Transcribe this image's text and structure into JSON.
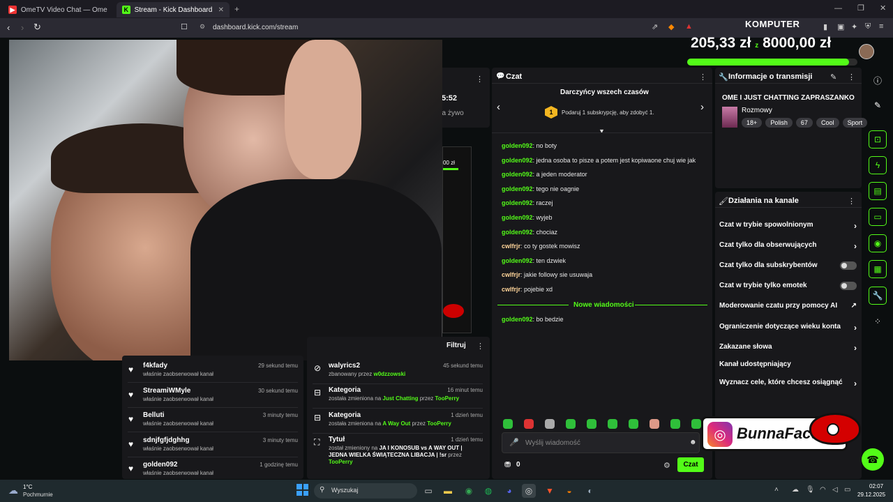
{
  "browser": {
    "tabs": [
      {
        "title": "OmeTV Video Chat — Omegle R"
      },
      {
        "title": "Stream - Kick Dashboard"
      }
    ],
    "url": "dashboard.kick.com/stream"
  },
  "overlay": {
    "logo_text": "KOMPUTER",
    "goal_current": "205,33 zł",
    "goal_separator": "z",
    "goal_target": "8000,00 zł",
    "partial_time": "5:52",
    "partial_live": "na żywo",
    "partial_value": "00 zł",
    "instagram_handle": "BunnaFactory"
  },
  "chat": {
    "title": "Czat",
    "top_gifters_title": "Darczyńcy wszech czasów",
    "top_rank": "1",
    "top_gifter_text": "Podaruj 1 subskrypcję, aby zdobyć 1.",
    "messages": [
      {
        "user": "golden092",
        "text": "no boty"
      },
      {
        "user": "golden092",
        "text": "jedna osoba to pisze a potem jest kopiwaone chuj wie jak"
      },
      {
        "user": "golden092",
        "text": "a jeden moderator"
      },
      {
        "user": "golden092",
        "text": "tego nie oagnie"
      },
      {
        "user": "golden092",
        "text": "raczej"
      },
      {
        "user": "golden092",
        "text": "wyjeb"
      },
      {
        "user": "golden092",
        "text": "chociaz"
      },
      {
        "user": "cwlfrjr",
        "text": "co ty gostek mowisz"
      },
      {
        "user": "golden092",
        "text": "ten dzwiek"
      },
      {
        "user": "cwlfrjr",
        "text": "jakie followy sie usuwaja"
      },
      {
        "user": "cwlfrjr",
        "text": "pojebie xd"
      }
    ],
    "new_messages_label": "Nowe wiadomości",
    "new_message": {
      "user": "golden092",
      "text": "bo bedzie"
    },
    "input_placeholder": "Wyślij wiadomość",
    "points": "0",
    "send_label": "Czat"
  },
  "stream_info": {
    "title": "Informacje o transmisji",
    "stream_title": "OME I JUST CHATTING ZAPRASZANKO",
    "category": "Rozmowy",
    "tags": [
      "18+",
      "Polish",
      "67",
      "Cool",
      "Sport"
    ]
  },
  "channel_actions": {
    "title": "Działania na kanale",
    "items": [
      {
        "label": "Czat w trybie spowolnionym",
        "control": "chevron"
      },
      {
        "label": "Czat tylko dla obserwujących",
        "control": "chevron"
      },
      {
        "label": "Czat tylko dla subskrybentów",
        "control": "toggle"
      },
      {
        "label": "Czat w trybie tylko emotek",
        "control": "toggle"
      },
      {
        "label": "Moderowanie czatu przy pomocy AI",
        "control": "external"
      },
      {
        "label": "Ograniczenie dotyczące wieku konta",
        "control": "chevron"
      },
      {
        "label": "Zakazane słowa",
        "control": "chevron"
      },
      {
        "label": "Kanał udostępniający",
        "control": "none"
      },
      {
        "label": "Wyznacz cele, które chcesz osiągnąć",
        "control": "chevron"
      }
    ]
  },
  "followers": [
    {
      "name": "f4kfady",
      "sub": "właśnie zaobserwował kanał",
      "time": "29 sekund temu"
    },
    {
      "name": "StreamiWMyle",
      "sub": "właśnie zaobserwował kanał",
      "time": "30 sekund temu"
    },
    {
      "name": "Belluti",
      "sub": "właśnie zaobserwował kanał",
      "time": "3 minuty temu"
    },
    {
      "name": "sdnjfgfjdghhg",
      "sub": "właśnie zaobserwował kanał",
      "time": "3 minuty temu"
    },
    {
      "name": "golden092",
      "sub": "właśnie zaobserwował kanał",
      "time": "1 godzinę temu"
    }
  ],
  "mod_log": {
    "filter_label": "Filtruj",
    "events": [
      {
        "name": "walyrics2",
        "pre": "zbanowany przez ",
        "hl": "w0dzzowski",
        "mid": "",
        "hl2": "",
        "post": "",
        "time": "45 sekund temu"
      },
      {
        "name": "Kategoria",
        "pre": "została zmieniona na ",
        "hl": "Just Chatting",
        "mid": " przez ",
        "hl2": "TooPerry",
        "post": "",
        "time": "16 minut temu"
      },
      {
        "name": "Kategoria",
        "pre": "została zmieniona na ",
        "hl": "A Way Out",
        "mid": " przez ",
        "hl2": "TooPerry",
        "post": "",
        "time": "1 dzień temu"
      },
      {
        "name": "Tytuł",
        "pre": "został zmieniony na ",
        "hl": "JA I KONOSUB vs A WAY OUT | JEDNA WIELKA ŚWIĄTECZNA LIBACJA | !sr",
        "mid": " przez ",
        "hl2": "TooPerry",
        "post": "",
        "time": "1 dzień temu"
      }
    ]
  },
  "taskbar": {
    "weather_temp": "1°C",
    "weather_desc": "Pochmurnie",
    "search_placeholder": "Wyszukaj",
    "time": "02:07",
    "date": "29.12.2025"
  },
  "colors": {
    "accent": "#53fc18",
    "panel": "#18181b",
    "bg": "#0b0e0f"
  }
}
